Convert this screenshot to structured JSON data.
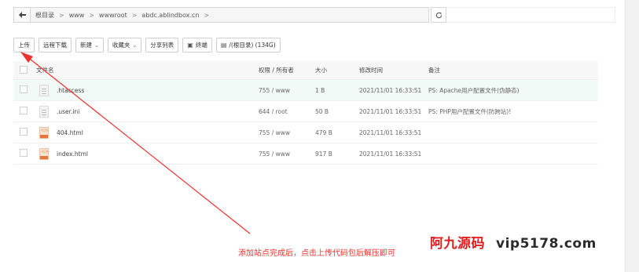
{
  "pathbar": {
    "segments": [
      "根目录",
      "www",
      "wwwroot",
      "abdc.ablindbox.cn"
    ],
    "refresh_icon": "refresh-icon"
  },
  "toolbar": {
    "upload": "上传",
    "remote_download": "远程下载",
    "new": "新建",
    "favorites": "收藏夹",
    "share_list": "分享列表",
    "terminal": "终端",
    "disk": "/(根目录) (134G)"
  },
  "table": {
    "headers": {
      "name": "文件名",
      "perm": "权限 / 所有者",
      "size": "大小",
      "mtime": "修改时间",
      "note": "备注"
    },
    "rows": [
      {
        "name": ".htaccess",
        "perm": "755 / www",
        "size": "1 B",
        "mtime": "2021/11/01 16:33:51",
        "note": "PS: Apache用户配置文件(伪静态)",
        "icon": "txt"
      },
      {
        "name": ".user.ini",
        "perm": "644 / root",
        "size": "50 B",
        "mtime": "2021/11/01 16:33:51",
        "note": "PS: PHP用户配置文件(防跨站)!",
        "icon": "txt"
      },
      {
        "name": "404.html",
        "perm": "755 / www",
        "size": "479 B",
        "mtime": "2021/11/01 16:33:51",
        "note": "",
        "icon": "html"
      },
      {
        "name": "index.html",
        "perm": "755 / www",
        "size": "917 B",
        "mtime": "2021/11/01 16:33:51",
        "note": "",
        "icon": "html"
      }
    ]
  },
  "annotation": "添加站点完成后，点击上传代码包后解压即可",
  "watermark": {
    "brand": "阿九源码",
    "site": "vip5178.com"
  },
  "colors": {
    "annotation_red": "#f0322d",
    "row_highlight": "#f2faf7"
  }
}
